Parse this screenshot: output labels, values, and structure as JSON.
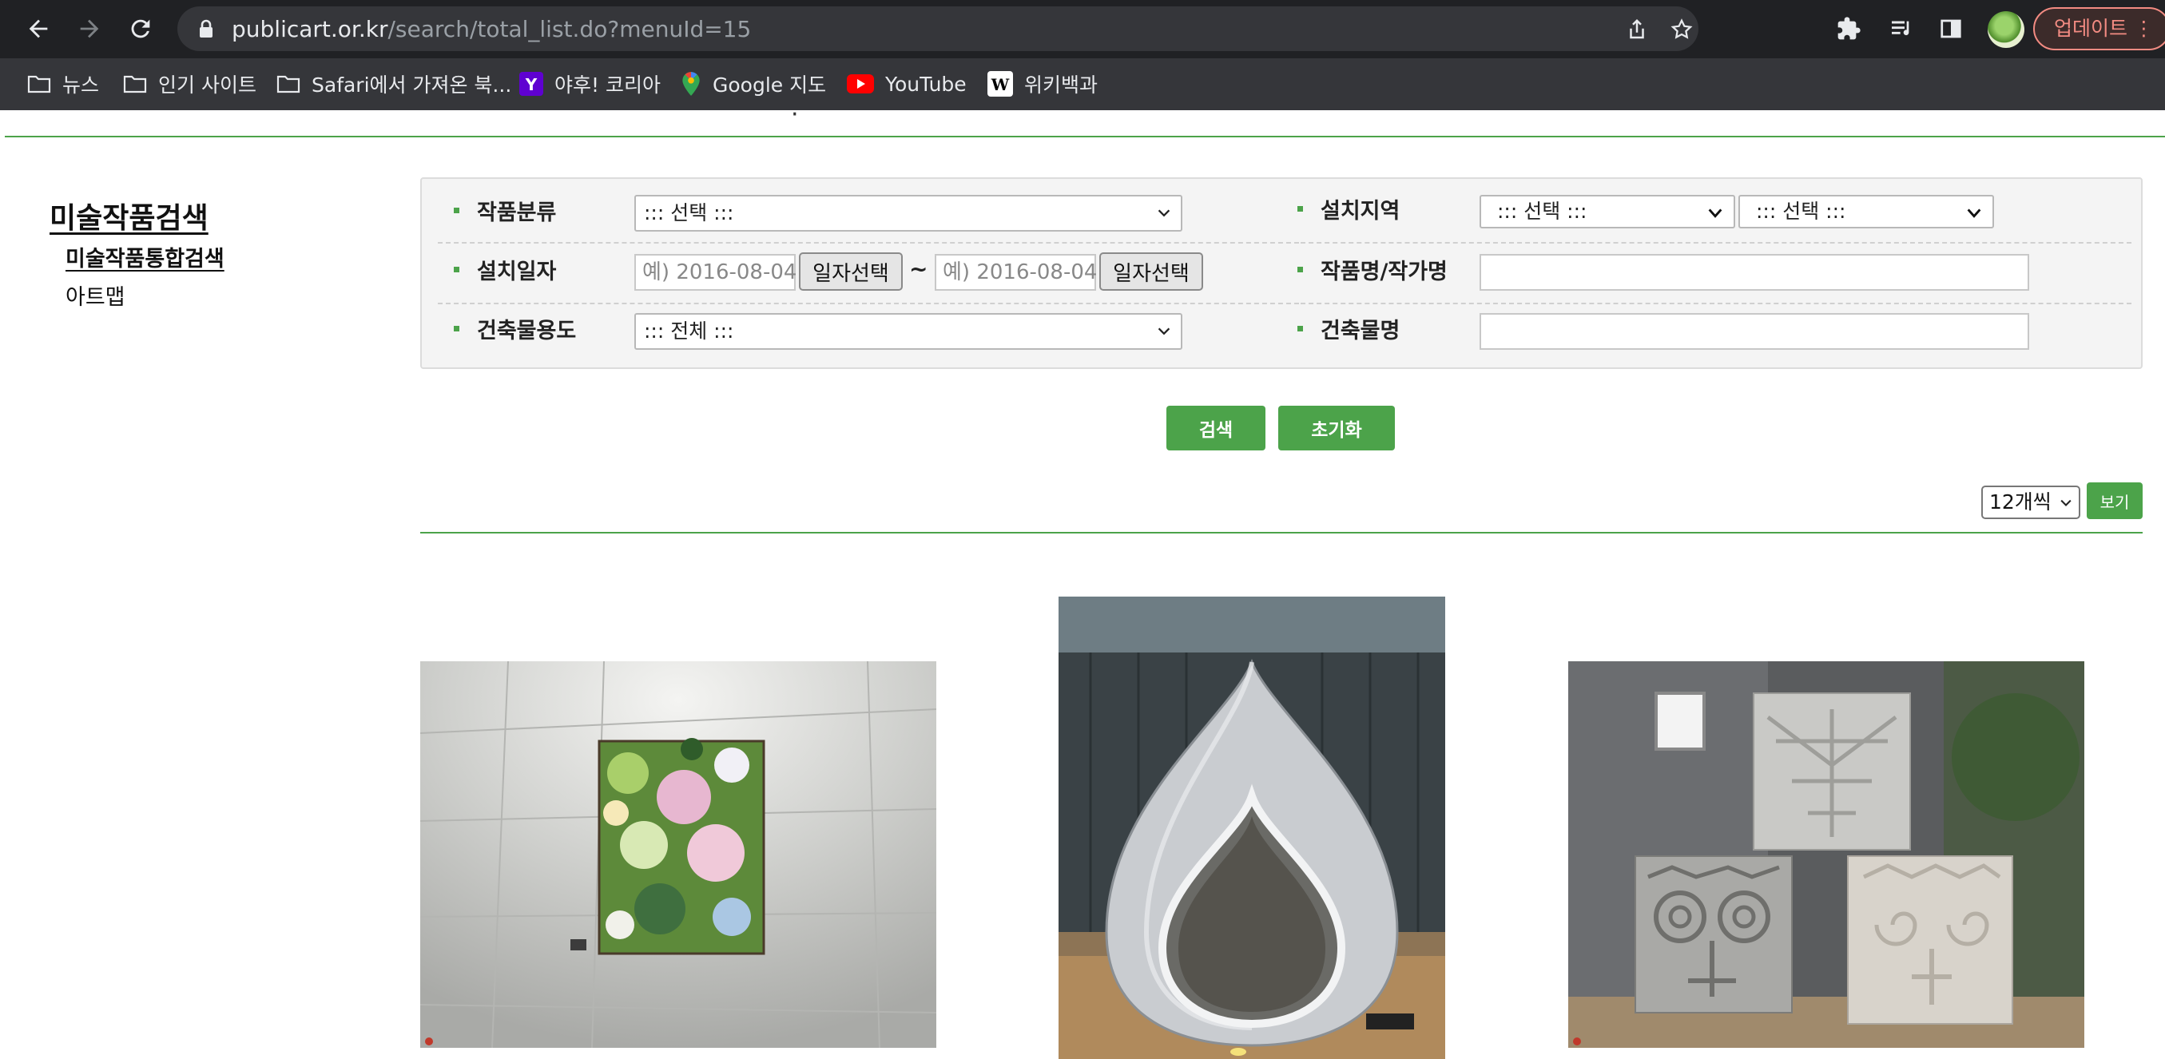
{
  "browser": {
    "url_host": "publicart.or.kr",
    "url_path": "/search/total_list.do?menuId=15",
    "update_label": "업데이트",
    "bookmarks": [
      {
        "label": "뉴스",
        "icon": "folder-icon"
      },
      {
        "label": "인기 사이트",
        "icon": "folder-icon"
      },
      {
        "label": "Safari에서 가져온 북...",
        "icon": "folder-icon"
      },
      {
        "label": "야후! 코리아",
        "icon": "yahoo-icon"
      },
      {
        "label": "Google 지도",
        "icon": "google-maps-icon"
      },
      {
        "label": "YouTube",
        "icon": "youtube-icon"
      },
      {
        "label": "위키백과",
        "icon": "wikipedia-icon"
      }
    ]
  },
  "sidebar": {
    "title": "미술작품검색",
    "items": [
      {
        "label": "미술작품통합검색",
        "active": true
      },
      {
        "label": "아트맵",
        "active": false
      }
    ]
  },
  "search": {
    "category_label": "작품분류",
    "category_value": "::: 선택 :::",
    "region_label": "설치지역",
    "region1_value": "::: 선택 :::",
    "region2_value": "::: 선택 :::",
    "date_label": "설치일자",
    "date_from_placeholder": "예) 2016-08-04",
    "date_to_placeholder": "예) 2016-08-04",
    "date_pick_label": "일자선택",
    "tilde": "~",
    "title_artist_label": "작품명/작가명",
    "title_artist_value": "",
    "usage_label": "건축물용도",
    "usage_value": "::: 전체 :::",
    "building_label": "건축물명",
    "building_value": "",
    "search_button": "검색",
    "reset_button": "초기화"
  },
  "list": {
    "per_page": "12개씩",
    "view_button": "보기"
  },
  "colors": {
    "accent": "#4ca34a",
    "chrome_dark": "#202124",
    "chrome_bar": "#35363a"
  }
}
